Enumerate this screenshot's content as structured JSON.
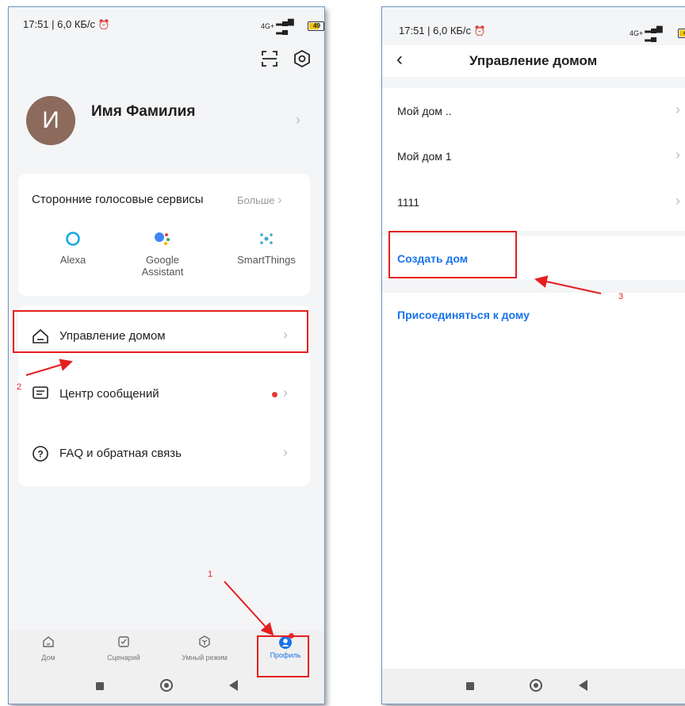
{
  "left": {
    "status": {
      "time": "17:51 | 6,0 КБ/с",
      "net": "4G+",
      "battery": "49"
    },
    "profile": {
      "avatar_letter": "И",
      "name": "Имя Фамилия"
    },
    "voice": {
      "title": "Сторонние голосовые сервисы",
      "more": "Больше",
      "services": [
        {
          "label": "Alexa",
          "icon": "alexa-icon"
        },
        {
          "label": "Google Assistant",
          "icon": "google-assistant-icon"
        },
        {
          "label": "SmartThings",
          "icon": "smartthings-icon"
        }
      ]
    },
    "menu": [
      {
        "label": "Управление домом",
        "icon": "home-icon"
      },
      {
        "label": "Центр сообщений",
        "icon": "message-icon"
      },
      {
        "label": "FAQ и обратная связь",
        "icon": "help-icon"
      }
    ],
    "tabs": [
      {
        "label": "Дом",
        "icon": "home-tab-icon"
      },
      {
        "label": "Сценарий",
        "icon": "scenario-icon"
      },
      {
        "label": "Умный режим",
        "icon": "smart-icon"
      },
      {
        "label": "Профиль",
        "icon": "profile-icon"
      }
    ],
    "annotations": {
      "n1": "1",
      "n2": "2"
    },
    "accent": "#1a73e8",
    "annotation_color": "#e41f1f"
  },
  "right": {
    "status": {
      "time": "17:51 | 6,0 КБ/с",
      "net": "4G+",
      "battery": "49"
    },
    "title": "Управление домом",
    "homes": [
      "Мой дом ..",
      "Мой дом 1",
      "1111"
    ],
    "create": "Создать дом",
    "join": "Присоединяться к дому",
    "annotations": {
      "n3": "3"
    }
  }
}
